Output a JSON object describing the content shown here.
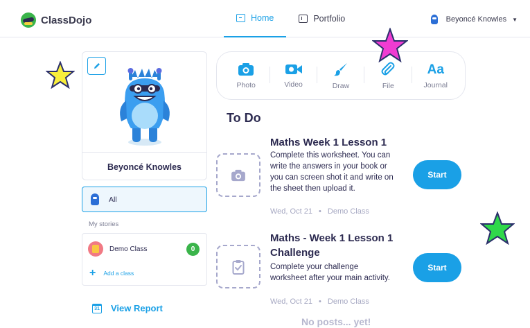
{
  "app": {
    "name": "ClassDojo"
  },
  "nav": {
    "tabs": [
      {
        "label": "Home",
        "active": true
      },
      {
        "label": "Portfolio",
        "active": false
      }
    ]
  },
  "user": {
    "name": "Beyoncé Knowles"
  },
  "profile": {
    "name": "Beyoncé Knowles"
  },
  "sidebar": {
    "all_label": "All",
    "stories_label": "My stories",
    "classes": [
      {
        "name": "Demo Class",
        "count": "0"
      }
    ],
    "add_class_label": "Add a class",
    "view_report_label": "View Report",
    "calendar_day": "31"
  },
  "tools": [
    {
      "label": "Photo",
      "icon": "camera-icon"
    },
    {
      "label": "Video",
      "icon": "video-icon"
    },
    {
      "label": "Draw",
      "icon": "brush-icon"
    },
    {
      "label": "File",
      "icon": "paperclip-icon"
    },
    {
      "label": "Journal",
      "icon": "journal-icon",
      "glyph": "Aa"
    }
  ],
  "todo": {
    "title": "To Do",
    "tasks": [
      {
        "title": "Maths Week 1 Lesson 1",
        "description": "Complete this worksheet. You can write the answers in your book or you can screen shot it and write on the sheet then upload it.",
        "date": "Wed, Oct 21",
        "separator": "•",
        "class": "Demo Class",
        "button": "Start",
        "icon": "camera-icon"
      },
      {
        "title": "Maths - Week 1 Lesson 1 Challenge",
        "description": "Complete your challenge worksheet after your main activity.",
        "date": "Wed, Oct 21",
        "separator": "•",
        "class": "Demo Class",
        "button": "Start",
        "icon": "clipboard-check-icon"
      }
    ]
  },
  "feed": {
    "empty_text": "No posts... yet!"
  },
  "colors": {
    "accent": "#1aa0e6",
    "text": "#2c2a50",
    "muted": "#7b7d93",
    "badge_green": "#3ab44a",
    "star_yellow": "#f8ee3c",
    "star_pink": "#f03cd2",
    "star_green": "#2fd84a"
  }
}
